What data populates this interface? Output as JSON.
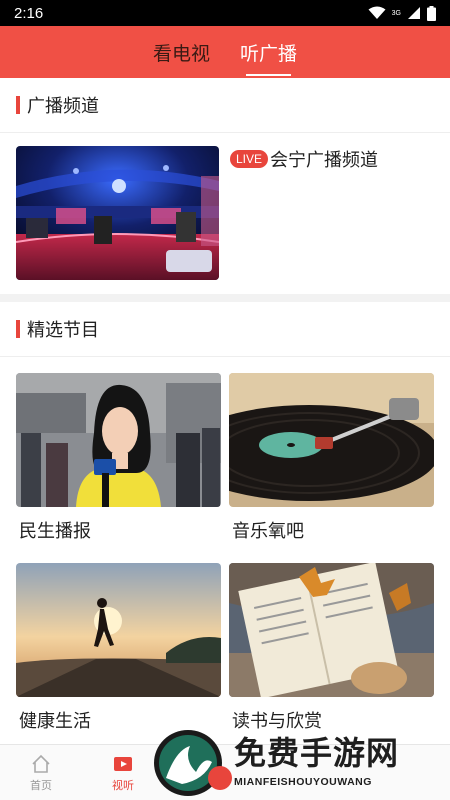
{
  "status_bar": {
    "time": "2:16",
    "network": "3G"
  },
  "header": {
    "tabs": [
      {
        "label": "看电视",
        "active": false
      },
      {
        "label": "听广播",
        "active": true
      }
    ]
  },
  "broadcast_section": {
    "title": "广播频道",
    "channel": {
      "badge": "LIVE",
      "name": "会宁广播频道"
    }
  },
  "featured_section": {
    "title": "精选节目",
    "programs": [
      {
        "label": "民生播报"
      },
      {
        "label": "音乐氧吧"
      },
      {
        "label": "健康生活"
      },
      {
        "label": "读书与欣赏"
      }
    ]
  },
  "bottom_nav": {
    "items": [
      {
        "label": "首页",
        "icon": "home-icon",
        "active": false
      },
      {
        "label": "视听",
        "icon": "play-icon",
        "active": true
      }
    ]
  },
  "watermark": {
    "title": "免费手游网",
    "subtitle": "MIANFEISHOUYOUWANG"
  },
  "colors": {
    "accent": "#f05045",
    "badge": "#e8453c",
    "status_bar": "#000000"
  }
}
